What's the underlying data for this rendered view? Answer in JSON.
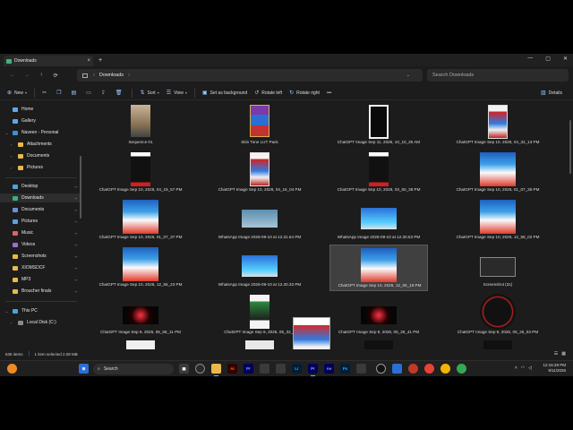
{
  "window": {
    "tab_label": "Downloads",
    "tab_close": "×",
    "new_tab": "+",
    "controls": [
      "—",
      "▢",
      "✕"
    ]
  },
  "address_bar": {
    "back": "←",
    "forward": "→",
    "up": "↑",
    "refresh": "⟳",
    "path": "Downloads",
    "path_sep": "›",
    "search_placeholder": "Search Downloads"
  },
  "toolbar": {
    "new_label": "New",
    "sort_label": "Sort",
    "view_label": "View",
    "set_background_label": "Set as background",
    "rotate_left_label": "Rotate left",
    "rotate_right_label": "Rotate right",
    "more_label": "•••",
    "details_label": "Details"
  },
  "sidebar": {
    "items": [
      {
        "label": "Home",
        "icon": "home-icon",
        "color": "#5fa8e8"
      },
      {
        "label": "Gallery",
        "icon": "gallery-icon",
        "color": "#5fa8e8"
      },
      {
        "label": "Naveen - Personal",
        "icon": "onedrive-icon",
        "color": "#3b8ede"
      },
      {
        "label": "Attachments",
        "icon": "folder-icon",
        "color": "#e9b949"
      },
      {
        "label": "Documents",
        "icon": "folder-icon",
        "color": "#e9b949"
      },
      {
        "label": "Pictures",
        "icon": "folder-icon",
        "color": "#e9b949"
      },
      {
        "label": "Desktop",
        "icon": "desktop-icon",
        "color": "#4aa3df"
      },
      {
        "label": "Downloads",
        "icon": "downloads-icon",
        "color": "#3bb07a"
      },
      {
        "label": "Documents",
        "icon": "documents-icon",
        "color": "#6c8fd8"
      },
      {
        "label": "Pictures",
        "icon": "pictures-icon",
        "color": "#5ca2e0"
      },
      {
        "label": "Music",
        "icon": "music-icon",
        "color": "#e0645c"
      },
      {
        "label": "Videos",
        "icon": "videos-icon",
        "color": "#9b6cd8"
      },
      {
        "label": "Screenshots",
        "icon": "folder-icon",
        "color": "#e9b949"
      },
      {
        "label": "XIOMSDCF",
        "icon": "folder-icon",
        "color": "#e9b949"
      },
      {
        "label": "MP3",
        "icon": "folder-icon",
        "color": "#e9b949"
      },
      {
        "label": "Broucher finals",
        "icon": "folder-icon",
        "color": "#e9b949"
      },
      {
        "label": "This PC",
        "icon": "pc-icon",
        "color": "#4aa3df"
      },
      {
        "label": "Local Disk (C:)",
        "icon": "disk-icon",
        "color": "#8a8a8a"
      }
    ]
  },
  "files": [
    {
      "name": "Sequence 01"
    },
    {
      "name": "Skin Tone LUT Pack"
    },
    {
      "name": "ChatGPT Image Sep 11, 2026, 10_10_25 AM"
    },
    {
      "name": "ChatGPT Image Sep 10, 2026, 04_32_13 PM"
    },
    {
      "name": "ChatGPT Image Sep 10, 2026, 04_19_57 PM"
    },
    {
      "name": "ChatGPT Image Sep 10, 2026, 04_16_04 PM"
    },
    {
      "name": "ChatGPT Image Sep 10, 2026, 03_50_38 PM"
    },
    {
      "name": "ChatGPT Image Sep 10, 2026, 01_07_35 PM"
    },
    {
      "name": "ChatGPT Image Sep 10, 2026, 01_07_37 PM"
    },
    {
      "name": "WhatsApp Image 2026-09-10 at 12.31.54 PM"
    },
    {
      "name": "WhatsApp Image 2026-09-10 at 12.30.53 PM"
    },
    {
      "name": "ChatGPT Image Sep 10, 2026, 12_58_02 PM"
    },
    {
      "name": "ChatGPT Image Sep 10, 2026, 12_55_23 PM"
    },
    {
      "name": "WhatsApp Image 2026-09-10 at 12.30.33 PM"
    },
    {
      "name": "ChatGPT Image Sep 10, 2026, 12_06_19 PM"
    },
    {
      "name": "Screenshot (31)"
    },
    {
      "name": "ChatGPT Image Sep 9, 2026, 05_58_11 PM"
    },
    {
      "name": "ChatGPT Image Sep 9, 2026, 05_32_4"
    },
    {
      "name": "ChatGPT Image Sep 9, 2026, 05_28_41 PM"
    },
    {
      "name": "ChatGPT Image Sep 9, 2026, 05_26_53 PM"
    }
  ],
  "status": {
    "item_count": "536 items",
    "selection": "1 item selected  2.08 MB"
  },
  "taskbar": {
    "search_label": "Search",
    "apps": [
      {
        "name": "Ai",
        "color": "#ff7c00",
        "bg": "#330000"
      },
      {
        "name": "Pr",
        "color": "#9999ff",
        "bg": "#00005b"
      },
      {
        "name": "Lr",
        "color": "#31a8ff",
        "bg": "#001e36"
      },
      {
        "name": "Pr",
        "color": "#9999ff",
        "bg": "#00005b"
      },
      {
        "name": "Ae",
        "color": "#9999ff",
        "bg": "#00005b"
      },
      {
        "name": "Ps",
        "color": "#31a8ff",
        "bg": "#001e36"
      }
    ],
    "time": "12:16:29 PM",
    "date": "9/11/2026"
  }
}
